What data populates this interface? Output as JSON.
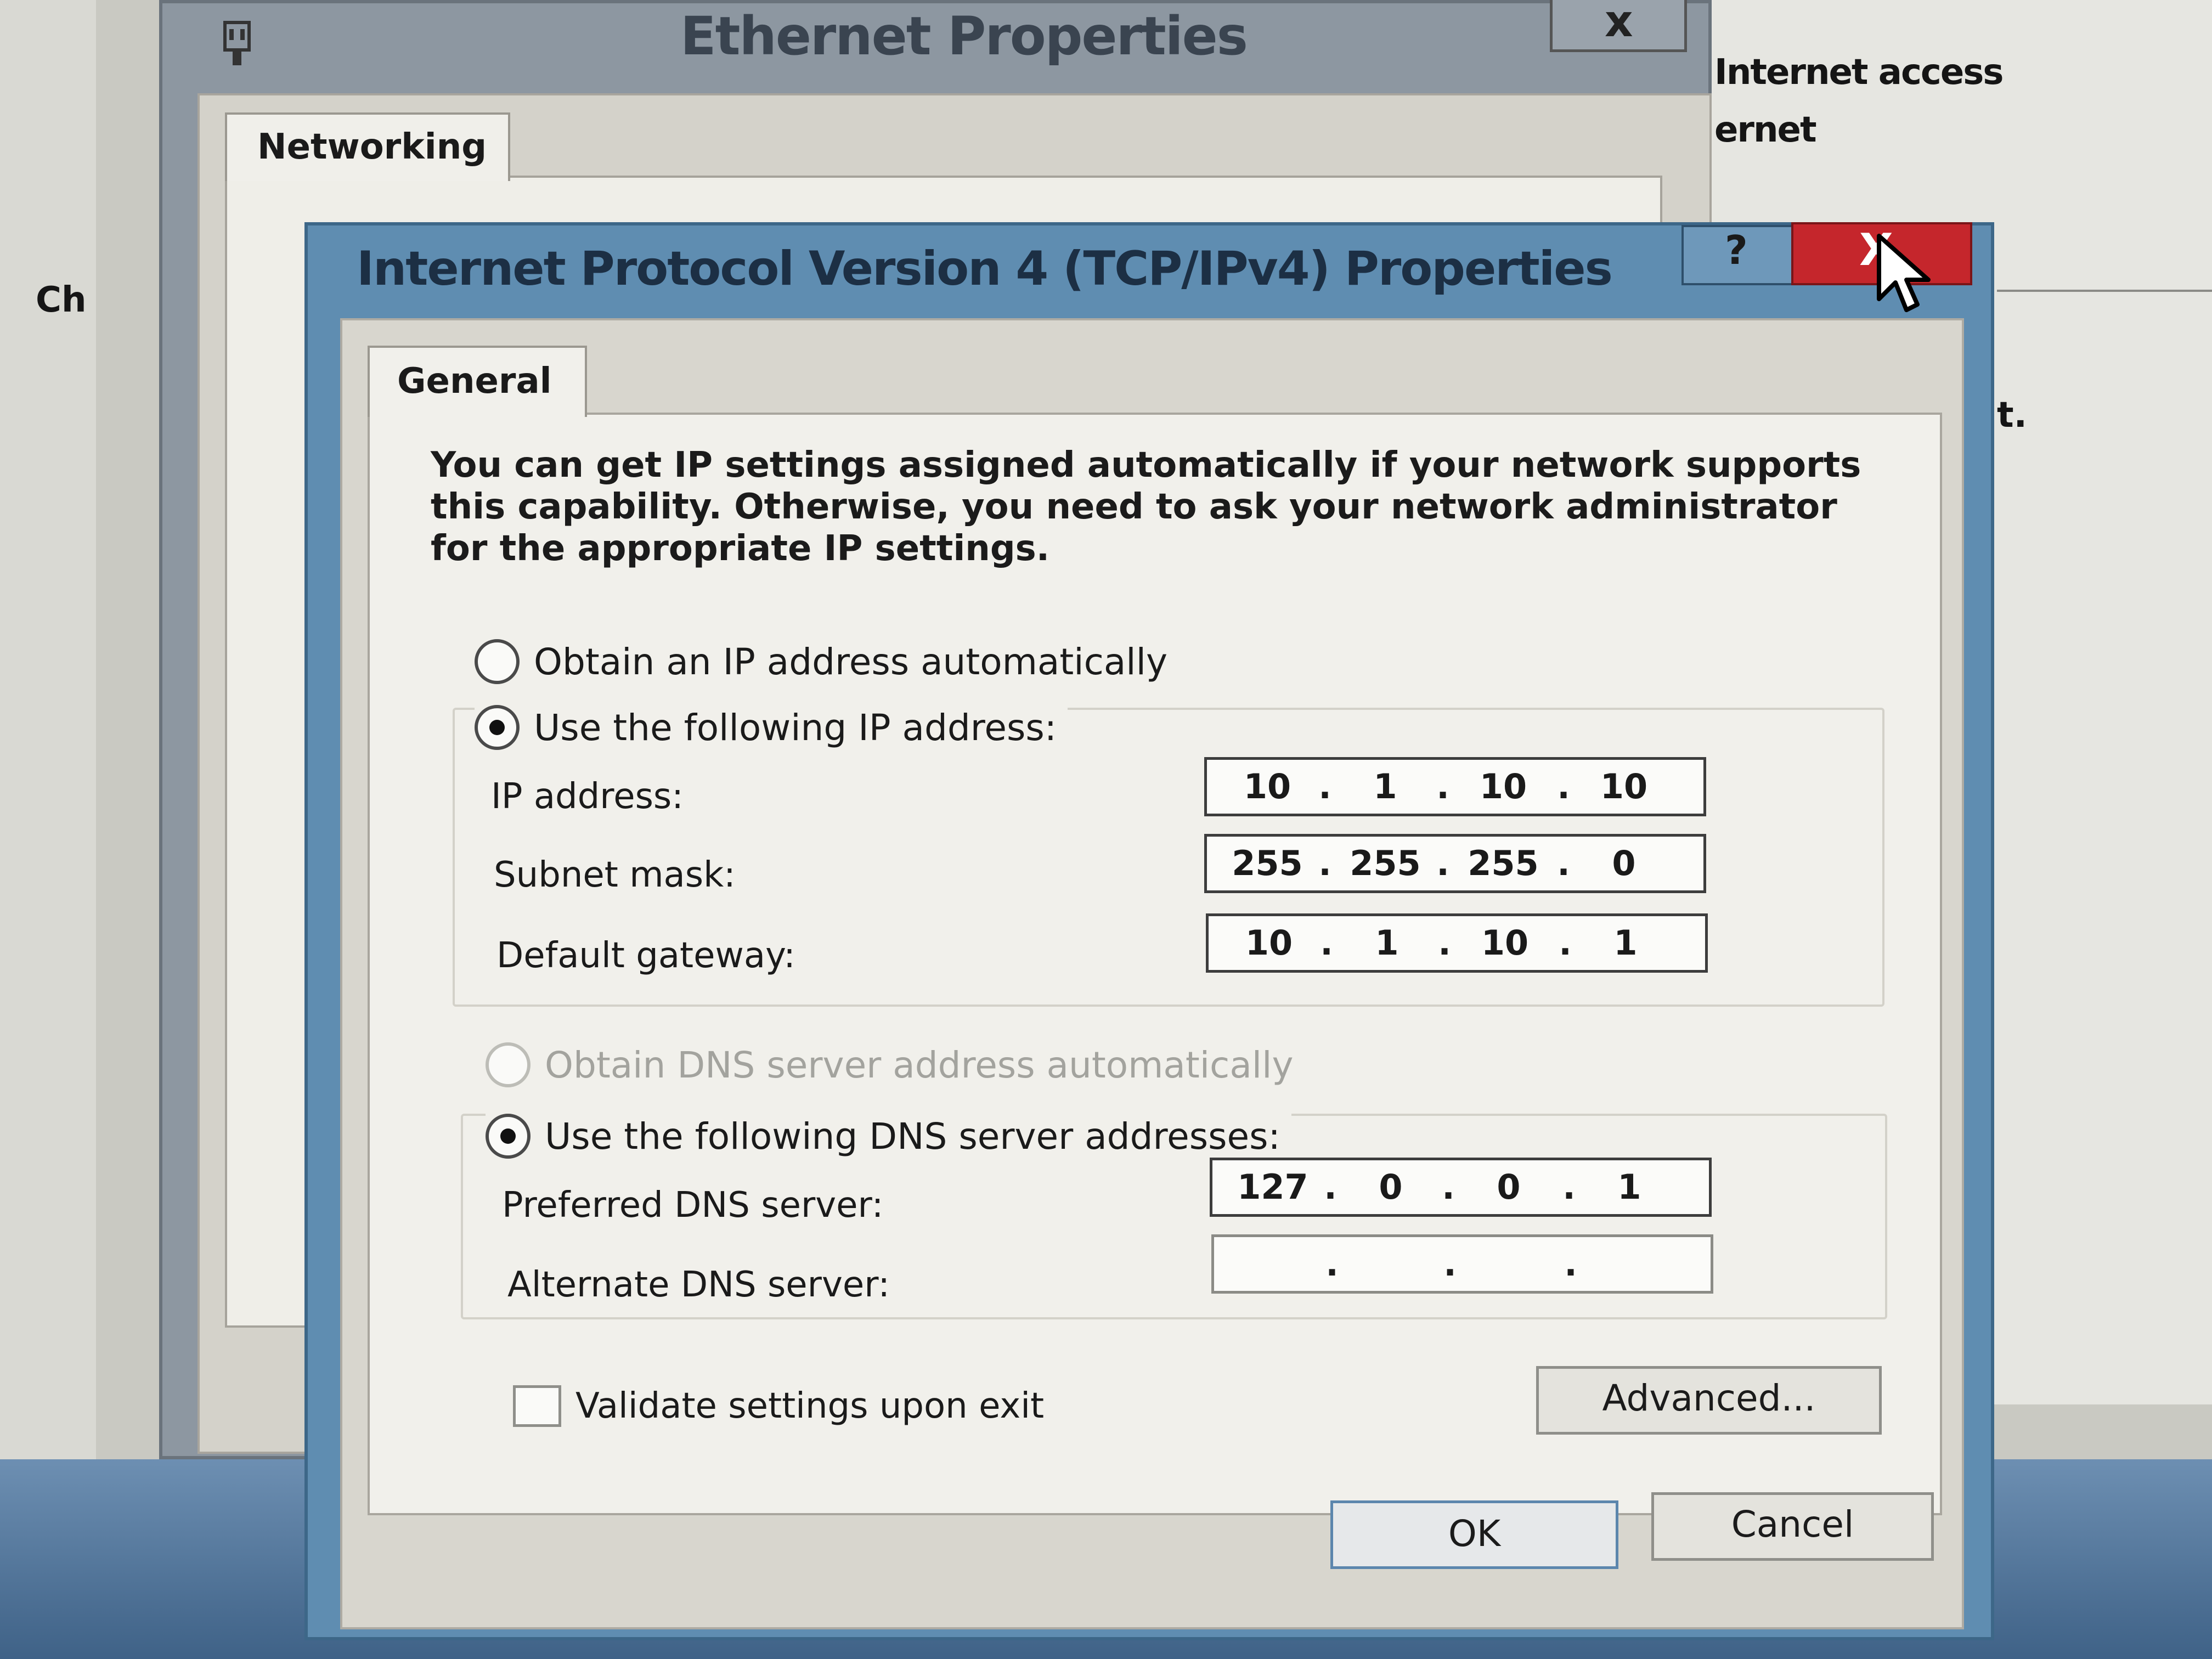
{
  "background": {
    "left_text": "Ch",
    "right_text_1": "Internet access",
    "right_text_2": "ernet",
    "right_text_3": "t."
  },
  "ethernet_window": {
    "title": "Ethernet Properties",
    "close_label": "x",
    "tab_networking": "Networking"
  },
  "dialog": {
    "title": "Internet Protocol Version 4 (TCP/IPv4) Properties",
    "help_label": "?",
    "close_label": "X",
    "tab_general": "General",
    "intro_line_1": "You can get IP settings assigned automatically if your network supports",
    "intro_line_2": "this capability. Otherwise, you need to ask your network administrator",
    "intro_line_3": "for the appropriate IP settings.",
    "radio_ip_auto": "Obtain an IP address automatically",
    "radio_ip_manual": "Use the following IP address:",
    "ip_address_label": "IP address:",
    "subnet_mask_label": "Subnet mask:",
    "default_gateway_label": "Default gateway:",
    "ip_address": [
      "10",
      "1",
      "10",
      "10"
    ],
    "subnet_mask": [
      "255",
      "255",
      "255",
      "0"
    ],
    "default_gateway": [
      "10",
      "1",
      "10",
      "1"
    ],
    "radio_dns_auto": "Obtain DNS server address automatically",
    "radio_dns_manual": "Use the following DNS server addresses:",
    "preferred_dns_label": "Preferred DNS server:",
    "alternate_dns_label": "Alternate DNS server:",
    "preferred_dns": [
      "127",
      "0",
      "0",
      "1"
    ],
    "alternate_dns": [
      "",
      "",
      "",
      ""
    ],
    "validate_label": "Validate settings upon exit",
    "advanced_button": "Advanced...",
    "ok_button": "OK",
    "cancel_button": "Cancel",
    "ip_mode_selected": "manual",
    "dns_mode_selected": "manual",
    "validate_checked": false
  },
  "colors": {
    "dialog_frame": "#5f8db1",
    "close_button": "#c5262c"
  }
}
